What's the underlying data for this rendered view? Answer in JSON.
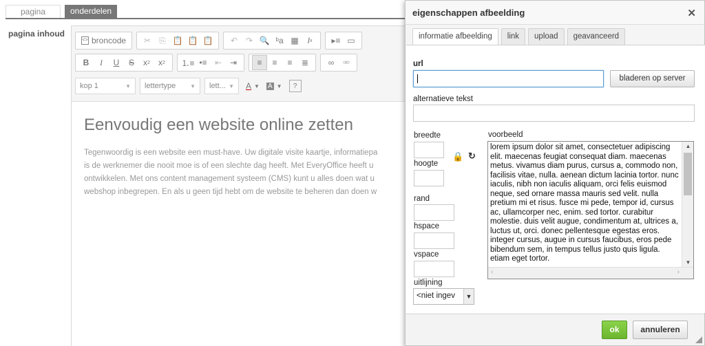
{
  "page_tabs": {
    "pagina": "pagina",
    "onderdelen": "onderdelen"
  },
  "content_label": "pagina inhoud",
  "toolbar": {
    "source": "broncode",
    "format": "kop 1",
    "font": "lettertype",
    "size": "lett...",
    "text_color": "A",
    "bg_color": "A",
    "help": "?",
    "bold": "B",
    "italic": "I",
    "underline": "U",
    "strike": "S"
  },
  "editor": {
    "heading": "Eenvoudig een website online zetten",
    "lines": [
      "Tegenwoordig is een website een must-have. Uw digitale visite kaartje, informatiepa",
      "is de werknemer die nooit moe is of een slechte dag heeft. Met EveryOffice heeft u",
      "ontwikkelen. Met ons content management systeem (CMS) kunt u alles doen wat u",
      "webshop inbegrepen. En als u geen tijd hebt om de website te beheren dan doen w"
    ]
  },
  "dialog": {
    "title": "eigenschappen afbeelding",
    "close": "✕",
    "tabs": [
      "informatie afbeelding",
      "link",
      "upload",
      "geavanceerd"
    ],
    "url_label": "url",
    "url_value": "",
    "browse_button": "bladeren op server",
    "alt_label": "alternatieve tekst",
    "alt_value": "",
    "width_label": "breedte",
    "height_label": "hoogte",
    "border_label": "rand",
    "hspace_label": "hspace",
    "vspace_label": "vspace",
    "align_label": "uitlijning",
    "align_value": "<niet ingev",
    "preview_label": "voorbeeld",
    "preview_text": "lorem ipsum dolor sit amet, consectetuer adipiscing elit. maecenas feugiat consequat diam. maecenas metus. vivamus diam purus, cursus a, commodo non, facilisis vitae, nulla. aenean dictum lacinia tortor. nunc iaculis, nibh non iaculis aliquam, orci felis euismod neque, sed ornare massa mauris sed velit. nulla pretium mi et risus. fusce mi pede, tempor id, cursus ac, ullamcorper nec, enim. sed tortor. curabitur molestie. duis velit augue, condimentum at, ultrices a, luctus ut, orci. donec pellentesque egestas eros. integer cursus, augue in cursus faucibus, eros pede bibendum sem, in tempus tellus justo quis ligula. etiam eget tortor.",
    "ok": "ok",
    "cancel": "annuleren"
  }
}
